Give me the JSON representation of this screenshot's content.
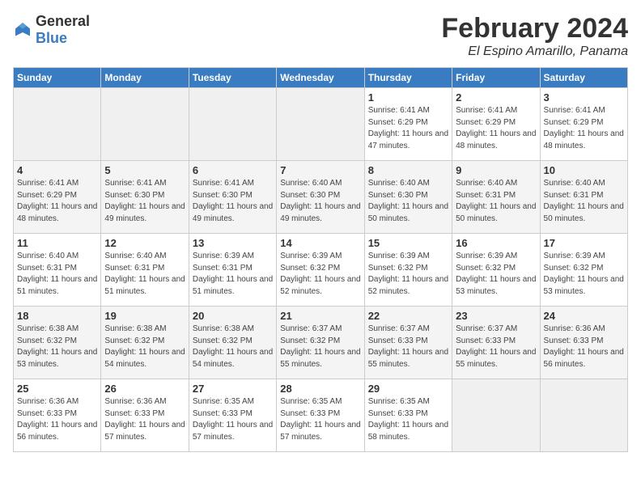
{
  "header": {
    "logo_general": "General",
    "logo_blue": "Blue",
    "month": "February 2024",
    "location": "El Espino Amarillo, Panama"
  },
  "weekdays": [
    "Sunday",
    "Monday",
    "Tuesday",
    "Wednesday",
    "Thursday",
    "Friday",
    "Saturday"
  ],
  "weeks": [
    [
      {
        "day": "",
        "empty": true
      },
      {
        "day": "",
        "empty": true
      },
      {
        "day": "",
        "empty": true
      },
      {
        "day": "",
        "empty": true
      },
      {
        "day": "1",
        "sunrise": "6:41 AM",
        "sunset": "6:29 PM",
        "daylight": "11 hours and 47 minutes."
      },
      {
        "day": "2",
        "sunrise": "6:41 AM",
        "sunset": "6:29 PM",
        "daylight": "11 hours and 48 minutes."
      },
      {
        "day": "3",
        "sunrise": "6:41 AM",
        "sunset": "6:29 PM",
        "daylight": "11 hours and 48 minutes."
      }
    ],
    [
      {
        "day": "4",
        "sunrise": "6:41 AM",
        "sunset": "6:29 PM",
        "daylight": "11 hours and 48 minutes."
      },
      {
        "day": "5",
        "sunrise": "6:41 AM",
        "sunset": "6:30 PM",
        "daylight": "11 hours and 49 minutes."
      },
      {
        "day": "6",
        "sunrise": "6:41 AM",
        "sunset": "6:30 PM",
        "daylight": "11 hours and 49 minutes."
      },
      {
        "day": "7",
        "sunrise": "6:40 AM",
        "sunset": "6:30 PM",
        "daylight": "11 hours and 49 minutes."
      },
      {
        "day": "8",
        "sunrise": "6:40 AM",
        "sunset": "6:30 PM",
        "daylight": "11 hours and 50 minutes."
      },
      {
        "day": "9",
        "sunrise": "6:40 AM",
        "sunset": "6:31 PM",
        "daylight": "11 hours and 50 minutes."
      },
      {
        "day": "10",
        "sunrise": "6:40 AM",
        "sunset": "6:31 PM",
        "daylight": "11 hours and 50 minutes."
      }
    ],
    [
      {
        "day": "11",
        "sunrise": "6:40 AM",
        "sunset": "6:31 PM",
        "daylight": "11 hours and 51 minutes."
      },
      {
        "day": "12",
        "sunrise": "6:40 AM",
        "sunset": "6:31 PM",
        "daylight": "11 hours and 51 minutes."
      },
      {
        "day": "13",
        "sunrise": "6:39 AM",
        "sunset": "6:31 PM",
        "daylight": "11 hours and 51 minutes."
      },
      {
        "day": "14",
        "sunrise": "6:39 AM",
        "sunset": "6:32 PM",
        "daylight": "11 hours and 52 minutes."
      },
      {
        "day": "15",
        "sunrise": "6:39 AM",
        "sunset": "6:32 PM",
        "daylight": "11 hours and 52 minutes."
      },
      {
        "day": "16",
        "sunrise": "6:39 AM",
        "sunset": "6:32 PM",
        "daylight": "11 hours and 53 minutes."
      },
      {
        "day": "17",
        "sunrise": "6:39 AM",
        "sunset": "6:32 PM",
        "daylight": "11 hours and 53 minutes."
      }
    ],
    [
      {
        "day": "18",
        "sunrise": "6:38 AM",
        "sunset": "6:32 PM",
        "daylight": "11 hours and 53 minutes."
      },
      {
        "day": "19",
        "sunrise": "6:38 AM",
        "sunset": "6:32 PM",
        "daylight": "11 hours and 54 minutes."
      },
      {
        "day": "20",
        "sunrise": "6:38 AM",
        "sunset": "6:32 PM",
        "daylight": "11 hours and 54 minutes."
      },
      {
        "day": "21",
        "sunrise": "6:37 AM",
        "sunset": "6:32 PM",
        "daylight": "11 hours and 55 minutes."
      },
      {
        "day": "22",
        "sunrise": "6:37 AM",
        "sunset": "6:33 PM",
        "daylight": "11 hours and 55 minutes."
      },
      {
        "day": "23",
        "sunrise": "6:37 AM",
        "sunset": "6:33 PM",
        "daylight": "11 hours and 55 minutes."
      },
      {
        "day": "24",
        "sunrise": "6:36 AM",
        "sunset": "6:33 PM",
        "daylight": "11 hours and 56 minutes."
      }
    ],
    [
      {
        "day": "25",
        "sunrise": "6:36 AM",
        "sunset": "6:33 PM",
        "daylight": "11 hours and 56 minutes."
      },
      {
        "day": "26",
        "sunrise": "6:36 AM",
        "sunset": "6:33 PM",
        "daylight": "11 hours and 57 minutes."
      },
      {
        "day": "27",
        "sunrise": "6:35 AM",
        "sunset": "6:33 PM",
        "daylight": "11 hours and 57 minutes."
      },
      {
        "day": "28",
        "sunrise": "6:35 AM",
        "sunset": "6:33 PM",
        "daylight": "11 hours and 57 minutes."
      },
      {
        "day": "29",
        "sunrise": "6:35 AM",
        "sunset": "6:33 PM",
        "daylight": "11 hours and 58 minutes."
      },
      {
        "day": "",
        "empty": true
      },
      {
        "day": "",
        "empty": true
      }
    ]
  ]
}
